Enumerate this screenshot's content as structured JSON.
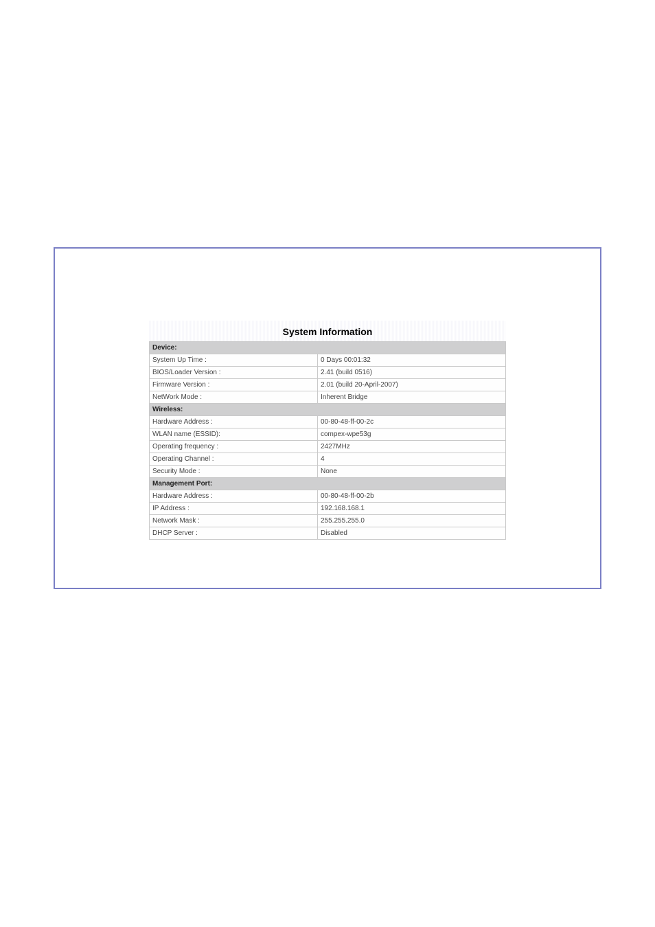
{
  "title": "System Information",
  "sections": [
    {
      "name": "Device:",
      "rows": [
        {
          "label": "System Up Time :",
          "value": "0 Days 00:01:32"
        },
        {
          "label": "BIOS/Loader Version :",
          "value": "2.41 (build 0516)"
        },
        {
          "label": "Firmware Version :",
          "value": "2.01 (build 20-April-2007)"
        },
        {
          "label": "NetWork Mode :",
          "value": "Inherent Bridge"
        }
      ]
    },
    {
      "name": "Wireless:",
      "rows": [
        {
          "label": "Hardware Address :",
          "value": "00-80-48-ff-00-2c"
        },
        {
          "label": "WLAN name (ESSID):",
          "value": "compex-wpe53g"
        },
        {
          "label": "Operating frequency :",
          "value": "2427MHz"
        },
        {
          "label": "Operating Channel :",
          "value": "4"
        },
        {
          "label": "Security Mode :",
          "value": "None"
        }
      ]
    },
    {
      "name": "Management Port:",
      "rows": [
        {
          "label": "Hardware Address :",
          "value": "00-80-48-ff-00-2b"
        },
        {
          "label": "IP Address :",
          "value": "192.168.168.1"
        },
        {
          "label": "Network Mask :",
          "value": "255.255.255.0"
        },
        {
          "label": "DHCP Server :",
          "value": "Disabled"
        }
      ]
    }
  ]
}
